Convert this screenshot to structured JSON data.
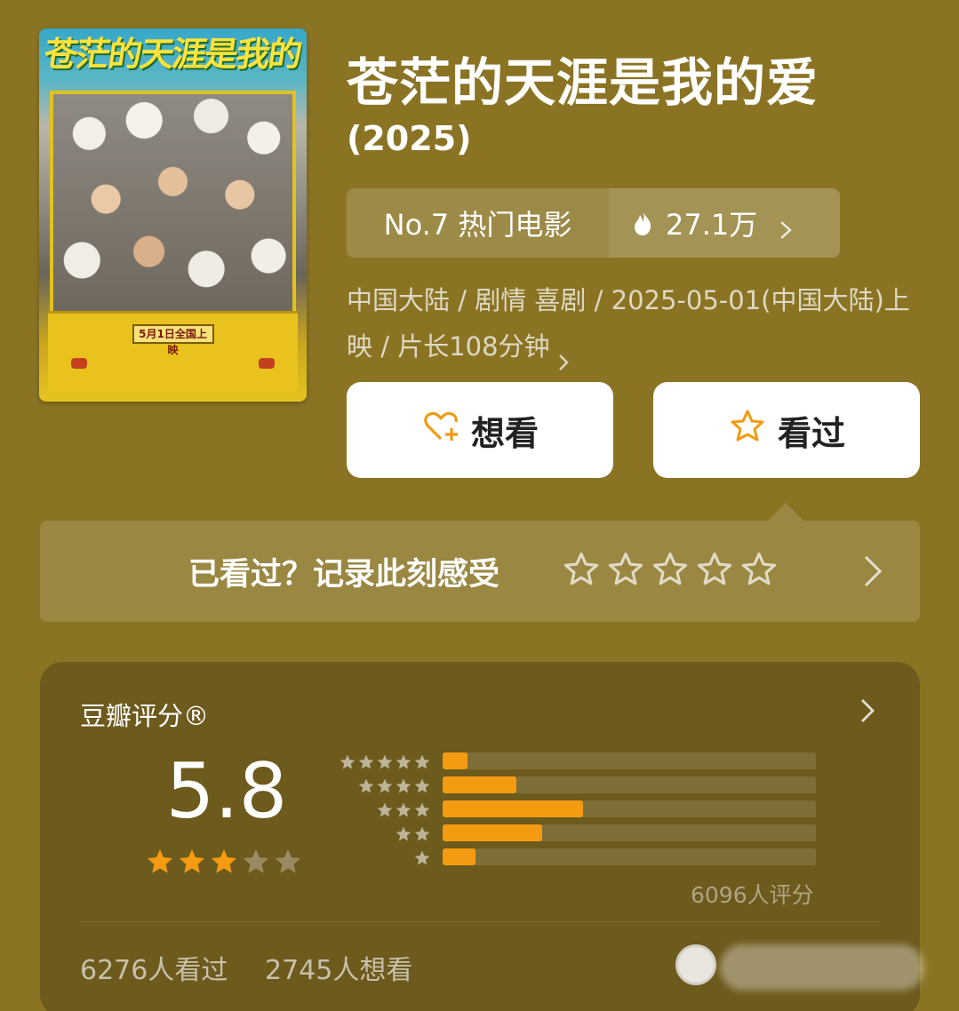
{
  "movie": {
    "title": "苍茫的天涯是我的爱",
    "year": "(2025)",
    "poster": {
      "title_art": "苍茫的天涯是我的爱",
      "sign": "5月1日全国上映"
    },
    "rank": {
      "label": "No.7 热门电影",
      "heat": "27.1万",
      "flame_icon": "flame-icon",
      "accent": "#ffffff"
    },
    "info": "中国大陆 / 剧情 喜剧 / 2025-05-01(中国大陆)上映 / 片长108分钟"
  },
  "actions": {
    "want": {
      "label": "想看",
      "icon": "heart-plus-icon",
      "icon_color": "#f29b11"
    },
    "seen": {
      "label": "看过",
      "icon": "star-outline-icon",
      "icon_color": "#f29b11"
    }
  },
  "record": {
    "text": "已看过？记录此刻感受",
    "stars": 5
  },
  "rating": {
    "label": "豆瓣评分®",
    "score": "5.8",
    "score_stars": 3,
    "max_stars": 5,
    "star_color": "#f49b12",
    "distribution": [
      {
        "stars": 5,
        "fraction": 0.066
      },
      {
        "stars": 4,
        "fraction": 0.197
      },
      {
        "stars": 3,
        "fraction": 0.376
      },
      {
        "stars": 2,
        "fraction": 0.267
      },
      {
        "stars": 1,
        "fraction": 0.088
      }
    ],
    "count": "6096人评分",
    "seen_count": "6276人看过",
    "want_count": "2745人想看"
  }
}
